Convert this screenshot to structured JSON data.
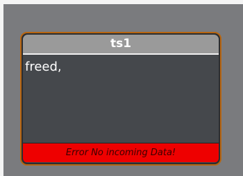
{
  "node": {
    "title": "ts1",
    "body_text": "freed,",
    "status_text": "Error No incoming Data!",
    "border_color": "#b8650f",
    "status_color": "#ee0000"
  }
}
